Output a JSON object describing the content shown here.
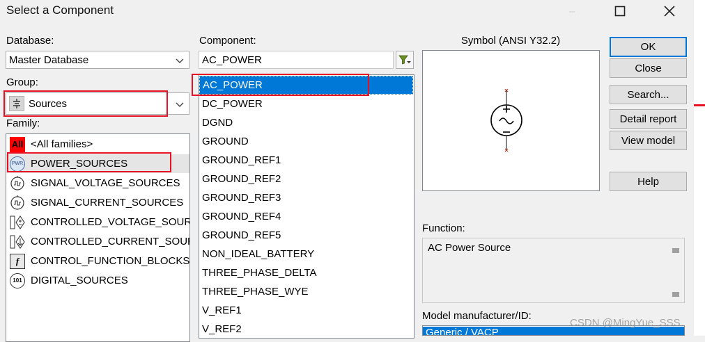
{
  "window": {
    "title": "Select a Component",
    "minimize": "–",
    "maximize_icon": "square-icon",
    "close_icon": "x-icon"
  },
  "database": {
    "label": "Database:",
    "value": "Master Database"
  },
  "group": {
    "label": "Group:",
    "value": "Sources",
    "icon": "sources-symbol-icon"
  },
  "family": {
    "label": "Family:",
    "items": [
      {
        "label": "<All families>",
        "icon": "all-icon",
        "icon_text": "All"
      },
      {
        "label": "POWER_SOURCES",
        "icon": "pwr-icon",
        "icon_text": "PWR"
      },
      {
        "label": "SIGNAL_VOLTAGE_SOURCES",
        "icon": "signal-voltage-icon"
      },
      {
        "label": "SIGNAL_CURRENT_SOURCES",
        "icon": "signal-current-icon"
      },
      {
        "label": "CONTROLLED_VOLTAGE_SOUR",
        "icon": "controlled-voltage-icon"
      },
      {
        "label": "CONTROLLED_CURRENT_SOUR",
        "icon": "controlled-current-icon"
      },
      {
        "label": "CONTROL_FUNCTION_BLOCKS",
        "icon": "control-function-icon",
        "icon_text": "f"
      },
      {
        "label": "DIGITAL_SOURCES",
        "icon": "digital-icon",
        "icon_text": "101"
      }
    ],
    "selected": "POWER_SOURCES"
  },
  "component": {
    "label": "Component:",
    "search_value": "AC_POWER",
    "filter_icon": "filter-icon",
    "items": [
      "AC_POWER",
      "DC_POWER",
      "DGND",
      "GROUND",
      "GROUND_REF1",
      "GROUND_REF2",
      "GROUND_REF3",
      "GROUND_REF4",
      "GROUND_REF5",
      "NON_IDEAL_BATTERY",
      "THREE_PHASE_DELTA",
      "THREE_PHASE_WYE",
      "V_REF1",
      "V_REF2"
    ],
    "selected": "AC_POWER"
  },
  "symbol": {
    "label": "Symbol (ANSI Y32.2)",
    "icon": "ac-source-symbol-icon"
  },
  "buttons": {
    "ok": "OK",
    "close": "Close",
    "search": "Search...",
    "detail_report": "Detail report",
    "view_model": "View model",
    "help": "Help"
  },
  "function": {
    "label": "Function:",
    "value": "AC Power Source"
  },
  "model": {
    "label": "Model manufacturer/ID:",
    "selected": "Generic / VACP"
  },
  "watermark": "CSDN @MingYue_SSS",
  "colors": {
    "selection": "#0078d7",
    "highlight_box": "#e81123",
    "all_icon_bg": "#ff0000"
  }
}
